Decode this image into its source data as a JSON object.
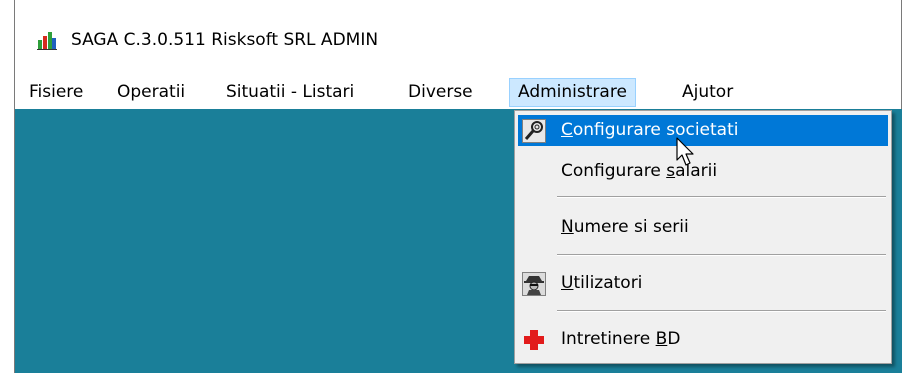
{
  "window": {
    "title": "SAGA C.3.0.511  Risksoft SRL  ADMIN",
    "icon": "saga-app-icon"
  },
  "menubar": {
    "items": [
      {
        "label": "Fisiere"
      },
      {
        "label": "Operatii"
      },
      {
        "label": "Situatii - Listari"
      },
      {
        "label": "Diverse"
      },
      {
        "label": "Administrare",
        "active": true
      },
      {
        "label": "Ajutor"
      }
    ]
  },
  "dropdown": {
    "items": [
      {
        "pre": "",
        "accel": "C",
        "post": "onfigurare societati",
        "icon": "wrench-icon",
        "highlighted": true
      },
      {
        "pre": "Configurare ",
        "accel": "s",
        "post": "alarii",
        "icon": ""
      },
      {
        "pre": "",
        "accel": "N",
        "post": "umere si serii",
        "icon": ""
      },
      {
        "pre": "",
        "accel": "U",
        "post": "tilizatori",
        "icon": "spy-user-icon"
      },
      {
        "pre": "Intretinere ",
        "accel": "B",
        "post": "D",
        "icon": "red-cross-icon"
      }
    ]
  },
  "colors": {
    "workspace": "#1a7f99",
    "highlight": "#0078d7",
    "menu_active_bg": "#cce8ff"
  }
}
